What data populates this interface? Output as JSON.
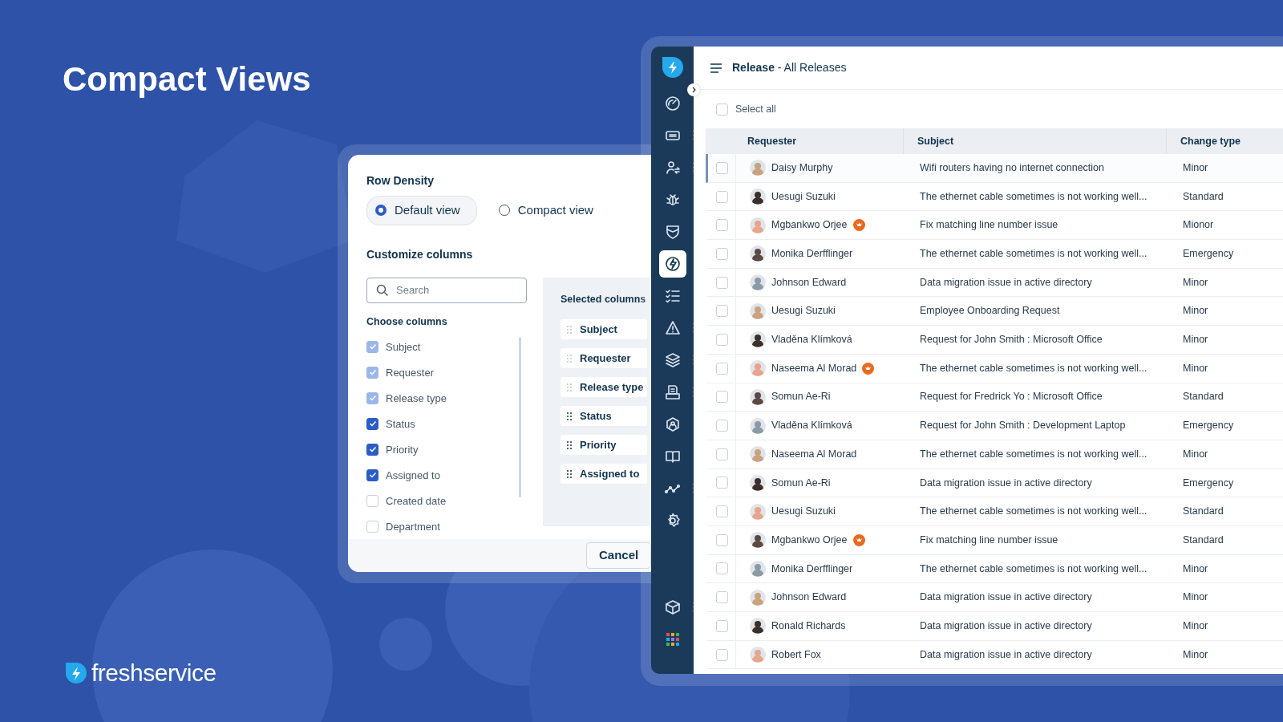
{
  "headline": "Compact Views",
  "brand": "freshservice",
  "dialog": {
    "density_title": "Row Density",
    "density_options": [
      {
        "label": "Default view",
        "selected": true
      },
      {
        "label": "Compact view",
        "selected": false
      }
    ],
    "customize_title": "Customize columns",
    "search": {
      "placeholder": "Search"
    },
    "choose_title": "Choose columns",
    "columns": [
      {
        "label": "Subject",
        "checked": true,
        "disabled": true
      },
      {
        "label": "Requester",
        "checked": true,
        "disabled": true
      },
      {
        "label": "Release type",
        "checked": true,
        "disabled": true
      },
      {
        "label": "Status",
        "checked": true,
        "disabled": false
      },
      {
        "label": "Priority",
        "checked": true,
        "disabled": false
      },
      {
        "label": "Assigned to",
        "checked": true,
        "disabled": false
      },
      {
        "label": "Created date",
        "checked": false,
        "disabled": false
      },
      {
        "label": "Department",
        "checked": false,
        "disabled": false
      }
    ],
    "selected_title": "Selected columns",
    "selected_columns": [
      {
        "label": "Subject",
        "locked": true
      },
      {
        "label": "Requester",
        "locked": true
      },
      {
        "label": "Release type",
        "locked": true
      },
      {
        "label": "Status",
        "locked": false
      },
      {
        "label": "Priority",
        "locked": false
      },
      {
        "label": "Assigned to",
        "locked": false
      }
    ],
    "buttons": [
      "Cancel"
    ]
  },
  "app": {
    "sidebar": {
      "items": [
        {
          "kind": "dashboard",
          "selected": false,
          "menu": false
        },
        {
          "kind": "ticket",
          "selected": false,
          "menu": true
        },
        {
          "kind": "users",
          "selected": false,
          "menu": true
        },
        {
          "kind": "bug",
          "selected": false,
          "menu": false
        },
        {
          "kind": "shield",
          "selected": false,
          "menu": false
        },
        {
          "kind": "release",
          "selected": true,
          "menu": false
        },
        {
          "kind": "checklist",
          "selected": false,
          "menu": false
        },
        {
          "kind": "warning",
          "selected": false,
          "menu": true
        },
        {
          "kind": "layers",
          "selected": false,
          "menu": true
        },
        {
          "kind": "printer",
          "selected": false,
          "menu": true
        },
        {
          "kind": "asset",
          "selected": false,
          "menu": false
        },
        {
          "kind": "book",
          "selected": false,
          "menu": false
        },
        {
          "kind": "analytics",
          "selected": false,
          "menu": true
        },
        {
          "kind": "gear",
          "selected": false,
          "menu": false
        }
      ],
      "bottom_items": [
        {
          "kind": "cube",
          "selected": false,
          "menu": true
        },
        {
          "kind": "apps",
          "selected": false,
          "menu": false
        }
      ]
    },
    "title": "**Release** - All Releases",
    "select_all": {
      "label": "Select all",
      "checked": false
    },
    "table": {
      "columns": [
        "Requester",
        "Subject",
        "Change type"
      ],
      "rows": [
        {
          "requester": "Daisy Murphy",
          "vip": false,
          "subject": "Wifi routers having no internet connection",
          "change_type": "Minor",
          "checked": false,
          "selected": true
        },
        {
          "requester": "Uesugi Suzuki",
          "vip": false,
          "subject": "The ethernet cable sometimes is not working well...",
          "change_type": "Standard",
          "checked": false,
          "selected": false
        },
        {
          "requester": "Mgbankwo Orjee",
          "vip": true,
          "subject": "Fix matching line number issue",
          "change_type": "Mionor",
          "checked": false,
          "selected": false
        },
        {
          "requester": "Monika Derfflinger",
          "vip": false,
          "subject": "The ethernet cable sometimes is not working well...",
          "change_type": "Emergency",
          "checked": false,
          "selected": false
        },
        {
          "requester": "Johnson Edward",
          "vip": false,
          "subject": "Data migration issue in active directory",
          "change_type": "Minor",
          "checked": false,
          "selected": false
        },
        {
          "requester": "Uesugi Suzuki",
          "vip": false,
          "subject": "Employee Onboarding Request",
          "change_type": "Minor",
          "checked": false,
          "selected": false
        },
        {
          "requester": "Vladěna Klímková",
          "vip": false,
          "subject": "Request for John Smith : Microsoft Office",
          "change_type": "Minor",
          "checked": false,
          "selected": false
        },
        {
          "requester": "Naseema Al Morad",
          "vip": true,
          "subject": "The ethernet cable sometimes is not working well...",
          "change_type": "Minor",
          "checked": false,
          "selected": false
        },
        {
          "requester": "Somun Ae-Ri",
          "vip": false,
          "subject": "Request for Fredrick Yo : Microsoft Office",
          "change_type": "Standard",
          "checked": false,
          "selected": false
        },
        {
          "requester": "Vladěna Klímková",
          "vip": false,
          "subject": "Request for John Smith : Development Laptop",
          "change_type": "Emergency",
          "checked": false,
          "selected": false
        },
        {
          "requester": "Naseema Al Morad",
          "vip": false,
          "subject": "The ethernet cable sometimes is not working well...",
          "change_type": "Minor",
          "checked": false,
          "selected": false
        },
        {
          "requester": "Somun Ae-Ri",
          "vip": false,
          "subject": "Data migration issue in active directory",
          "change_type": "Emergency",
          "checked": false,
          "selected": false
        },
        {
          "requester": "Uesugi Suzuki",
          "vip": false,
          "subject": "The ethernet cable sometimes is not working well...",
          "change_type": "Standard",
          "checked": false,
          "selected": false
        },
        {
          "requester": "Mgbankwo Orjee",
          "vip": true,
          "subject": "Fix matching line number issue",
          "change_type": "Standard",
          "checked": false,
          "selected": false
        },
        {
          "requester": "Monika Derfflinger",
          "vip": false,
          "subject": "The ethernet cable sometimes is not working well...",
          "change_type": "Minor",
          "checked": false,
          "selected": false
        },
        {
          "requester": "Johnson Edward",
          "vip": false,
          "subject": "Data migration issue in active directory",
          "change_type": "Minor",
          "checked": false,
          "selected": false
        },
        {
          "requester": "Ronald Richards",
          "vip": false,
          "subject": "Data migration issue in active directory",
          "change_type": "Minor",
          "checked": false,
          "selected": false
        },
        {
          "requester": "Robert Fox",
          "vip": false,
          "subject": "Data migration issue in active directory",
          "change_type": "Minor",
          "checked": false,
          "selected": false
        }
      ]
    }
  }
}
